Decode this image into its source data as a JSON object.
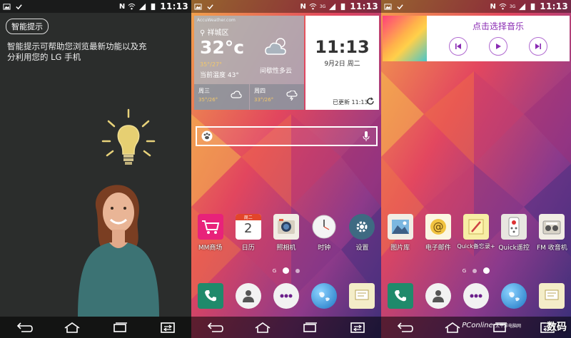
{
  "status": {
    "time": "11:13",
    "net": "3G"
  },
  "panel1": {
    "tip_button": "智能提示",
    "tip_text": "智能提示可帮助您浏览最新功能以及充分利用您的 LG 手机"
  },
  "weather": {
    "source": "AccuWeather.com",
    "location": "祥城区",
    "temp": "32°c",
    "range": "35°/27°",
    "feels": "当前温度 43°",
    "condition": "间歇性多云",
    "forecast": [
      {
        "day": "周三",
        "range": "35°/26°"
      },
      {
        "day": "周四",
        "range": "33°/26°"
      }
    ]
  },
  "clock": {
    "time": "11:13",
    "date": "9月2日 周二",
    "updated": "已更新 11:13"
  },
  "apps_page2": [
    {
      "label": "MM商场",
      "icon": "cart-icon",
      "color": "#e8227a"
    },
    {
      "label": "日历",
      "icon": "calendar-icon",
      "color": "#ffffff",
      "date_num": "2",
      "date_head": "周二"
    },
    {
      "label": "照相机",
      "icon": "camera-icon",
      "color": "#ffffff"
    },
    {
      "label": "时钟",
      "icon": "clock-icon",
      "color": "#ffffff"
    },
    {
      "label": "设置",
      "icon": "gear-icon",
      "color": "#3e6a82"
    }
  ],
  "apps_page3": [
    {
      "label": "图片库",
      "icon": "gallery-icon",
      "color": "#ffffff"
    },
    {
      "label": "电子邮件",
      "icon": "email-icon",
      "color": "#ffffff"
    },
    {
      "label": "Quick备忘录+",
      "icon": "memo-icon",
      "color": "#ffffff"
    },
    {
      "label": "Quick遥控",
      "icon": "remote-icon",
      "color": "#ffffff"
    },
    {
      "label": "FM 收音机",
      "icon": "radio-icon",
      "color": "#ffffff"
    }
  ],
  "home_indicator": "G",
  "music": {
    "title": "点击选择音乐"
  },
  "watermark": {
    "site": "PConline",
    "brand": "太平洋电脑网",
    "logo": "数码"
  }
}
